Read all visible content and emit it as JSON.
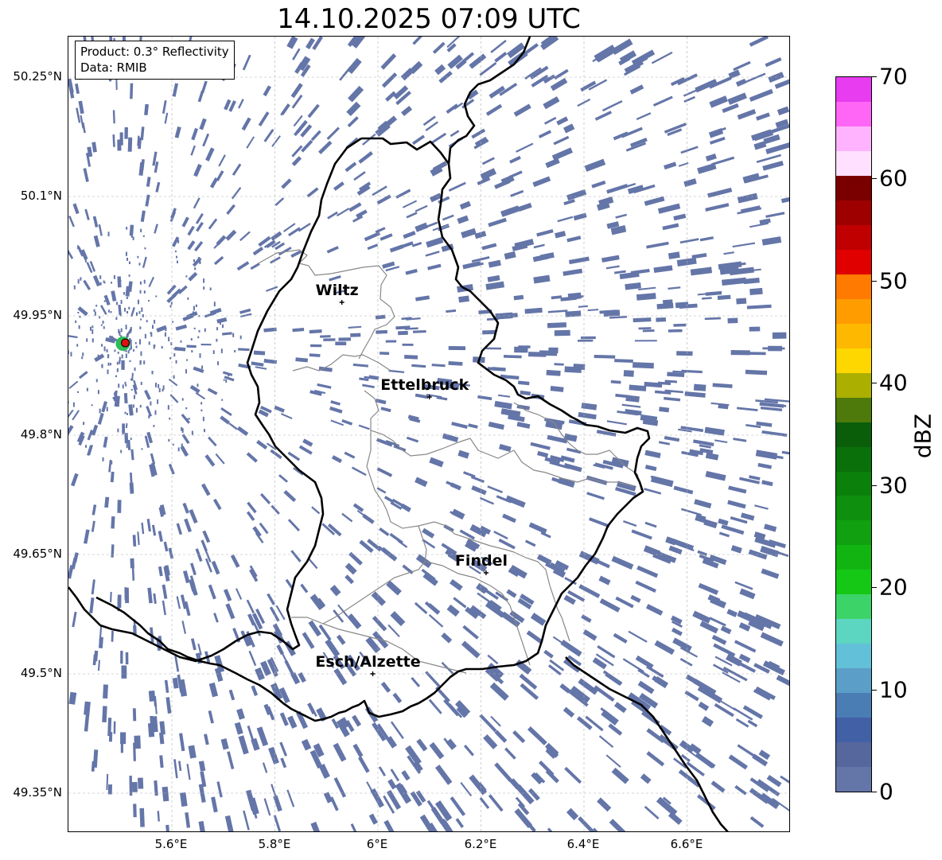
{
  "title": "14.10.2025 07:09 UTC",
  "info": {
    "product": "Product: 0.3° Reflectivity",
    "data": "Data: RMIB"
  },
  "map": {
    "lon_range": [
      5.4,
      6.8
    ],
    "lat_range": [
      49.3,
      50.3
    ],
    "lat_ticks": [
      "50.25°N",
      "50.1°N",
      "49.95°N",
      "49.8°N",
      "49.65°N",
      "49.5°N",
      "49.35°N"
    ],
    "lon_ticks": [
      "5.6°E",
      "5.8°E",
      "6°E",
      "6.2°E",
      "6.4°E",
      "6.6°E"
    ],
    "grid": true,
    "radar_site": {
      "lon": 5.505,
      "lat": 49.915
    },
    "cities": [
      {
        "name": "Wiltz",
        "lon": 5.93,
        "lat": 49.967
      },
      {
        "name": "Ettelbruck",
        "lon": 6.1,
        "lat": 49.848
      },
      {
        "name": "Findel",
        "lon": 6.21,
        "lat": 49.627
      },
      {
        "name": "Esch/Alzette",
        "lon": 5.99,
        "lat": 49.5
      }
    ],
    "echo_color": "#6475a8",
    "border_color": "#000000",
    "canton_color": "#888888"
  },
  "colorbar": {
    "unit": "dBZ",
    "range": [
      0,
      70
    ],
    "labels": [
      "70",
      "60",
      "50",
      "40",
      "30",
      "20",
      "10",
      "0"
    ],
    "colors": [
      "#e83cf0",
      "#ff66f5",
      "#ffb3ff",
      "#ffe0ff",
      "#7a0000",
      "#9e0000",
      "#c00000",
      "#e00000",
      "#ff7a00",
      "#ff9c00",
      "#ffb800",
      "#ffd700",
      "#aaaf00",
      "#4d7a0a",
      "#0a5e0a",
      "#0a700a",
      "#0b800b",
      "#0e900e",
      "#10a010",
      "#12b412",
      "#15c815",
      "#3cd468",
      "#5cd6c0",
      "#63c0d9",
      "#5b9ec8",
      "#4b7db5",
      "#4260a6",
      "#56679e",
      "#6475a8"
    ]
  }
}
